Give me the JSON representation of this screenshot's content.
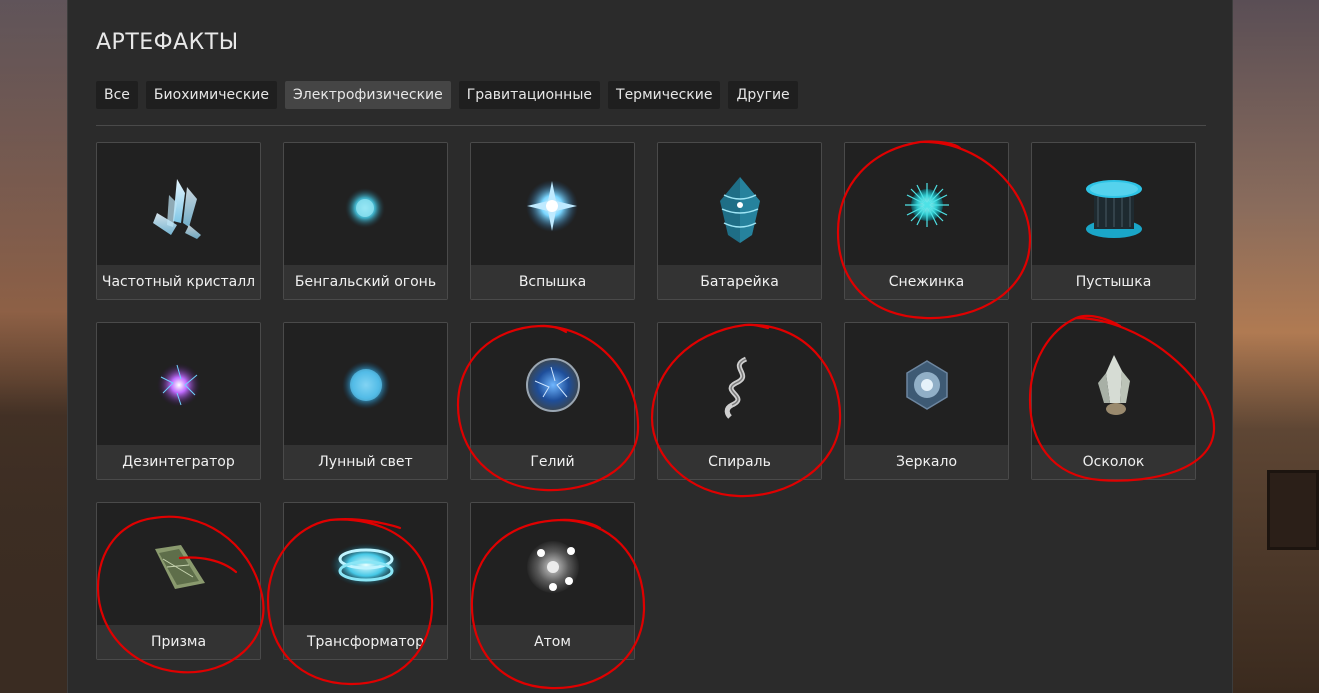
{
  "title": "АРТЕФАКТЫ",
  "tabs": [
    {
      "label": "Все",
      "active": false
    },
    {
      "label": "Биохимические",
      "active": false
    },
    {
      "label": "Электрофизические",
      "active": true
    },
    {
      "label": "Гравитационные",
      "active": false
    },
    {
      "label": "Термические",
      "active": false
    },
    {
      "label": "Другие",
      "active": false
    }
  ],
  "artifacts": [
    {
      "name": "Частотный кристалл",
      "icon": "crystal-icon"
    },
    {
      "name": "Бенгальский огонь",
      "icon": "sparkler-icon"
    },
    {
      "name": "Вспышка",
      "icon": "flash-icon"
    },
    {
      "name": "Батарейка",
      "icon": "battery-icon"
    },
    {
      "name": "Снежинка",
      "icon": "snowflake-icon"
    },
    {
      "name": "Пустышка",
      "icon": "dummy-icon"
    },
    {
      "name": "Дезинтегратор",
      "icon": "disintegrator-icon"
    },
    {
      "name": "Лунный свет",
      "icon": "moonlight-icon"
    },
    {
      "name": "Гелий",
      "icon": "helium-icon"
    },
    {
      "name": "Спираль",
      "icon": "spiral-icon"
    },
    {
      "name": "Зеркало",
      "icon": "mirror-icon"
    },
    {
      "name": "Осколок",
      "icon": "shard-icon"
    },
    {
      "name": "Призма",
      "icon": "prism-icon"
    },
    {
      "name": "Трансформатор",
      "icon": "transformer-icon"
    },
    {
      "name": "Атом",
      "icon": "atom-icon"
    }
  ],
  "colors": {
    "panel": "#2b2b2b",
    "tab_active": "#454545",
    "annotation": "#e00000"
  }
}
